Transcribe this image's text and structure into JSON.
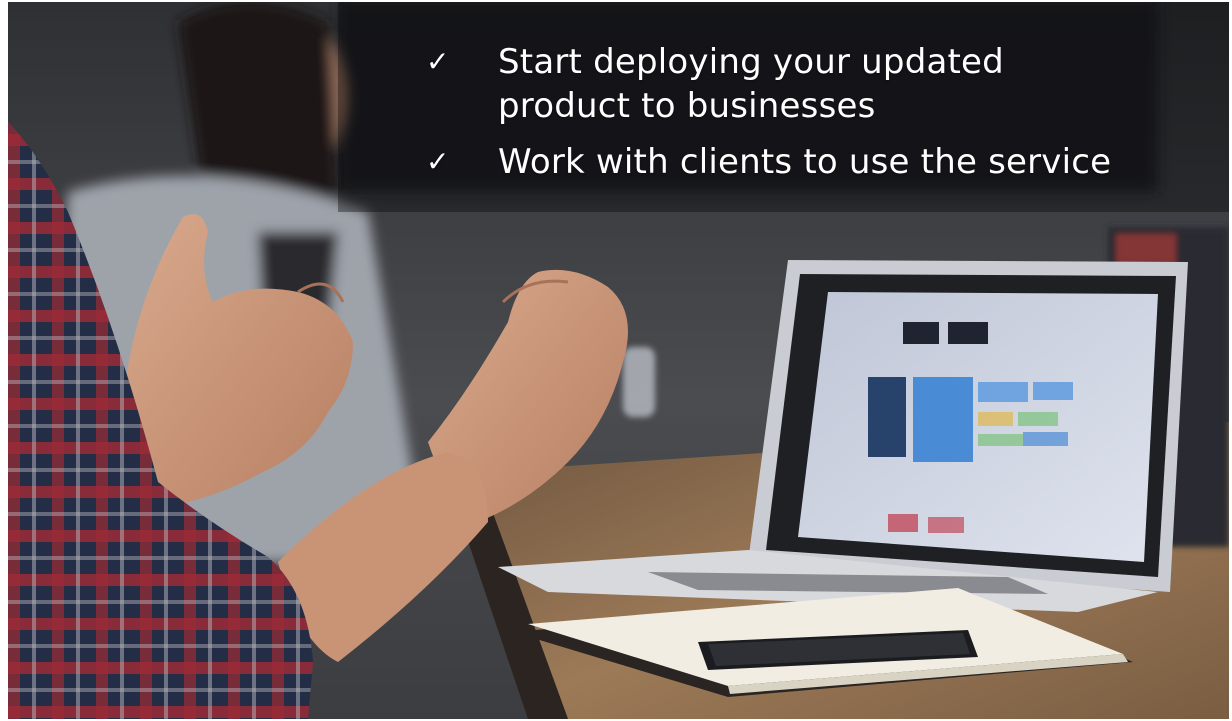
{
  "slide": {
    "bullets": [
      {
        "icon": "check-icon",
        "glyph": "✓",
        "text": "Start deploying your updated product to businesses"
      },
      {
        "icon": "check-icon",
        "glyph": "✓",
        "text": "Work with clients to use the service"
      }
    ],
    "background_image": "meeting-photo-hands-laptop"
  },
  "colors": {
    "text": "#ffffff",
    "backdrop": "#3a3b3d",
    "shirt_red": "#b8323f",
    "shirt_navy": "#2a3552",
    "table_wood": "#8a6a4a"
  }
}
